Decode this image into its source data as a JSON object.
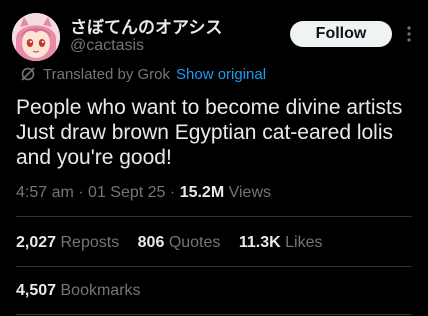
{
  "author": {
    "display_name": "さぼてんのオアシス",
    "handle": "@cactasis",
    "avatar_icon": "anime-girl-avatar"
  },
  "follow_button": {
    "label": "Follow"
  },
  "more_icon": "vertical-ellipsis-icon",
  "translation": {
    "label": "Translated by Grok",
    "show_original": "Show original",
    "icon": "grok-icon"
  },
  "tweet": {
    "lines": [
      "People who want to become divine artists",
      "Just draw brown Egyptian cat-eared lolis",
      "and you're good!"
    ]
  },
  "meta": {
    "time": "4:57 am",
    "date": "01 Sept 25",
    "views_count": "15.2M",
    "views_label": "Views",
    "separator": "·"
  },
  "stats": {
    "reposts": {
      "count": "2,027",
      "label": "Reposts"
    },
    "quotes": {
      "count": "806",
      "label": "Quotes"
    },
    "likes": {
      "count": "11.3K",
      "label": "Likes"
    },
    "bookmarks": {
      "count": "4,507",
      "label": "Bookmarks"
    }
  },
  "colors": {
    "background": "#000000",
    "text": "#e7e9ea",
    "secondary": "#71767b",
    "link": "#1d9bf0",
    "divider": "#2f3336",
    "follow_bg": "#eff3f4"
  }
}
